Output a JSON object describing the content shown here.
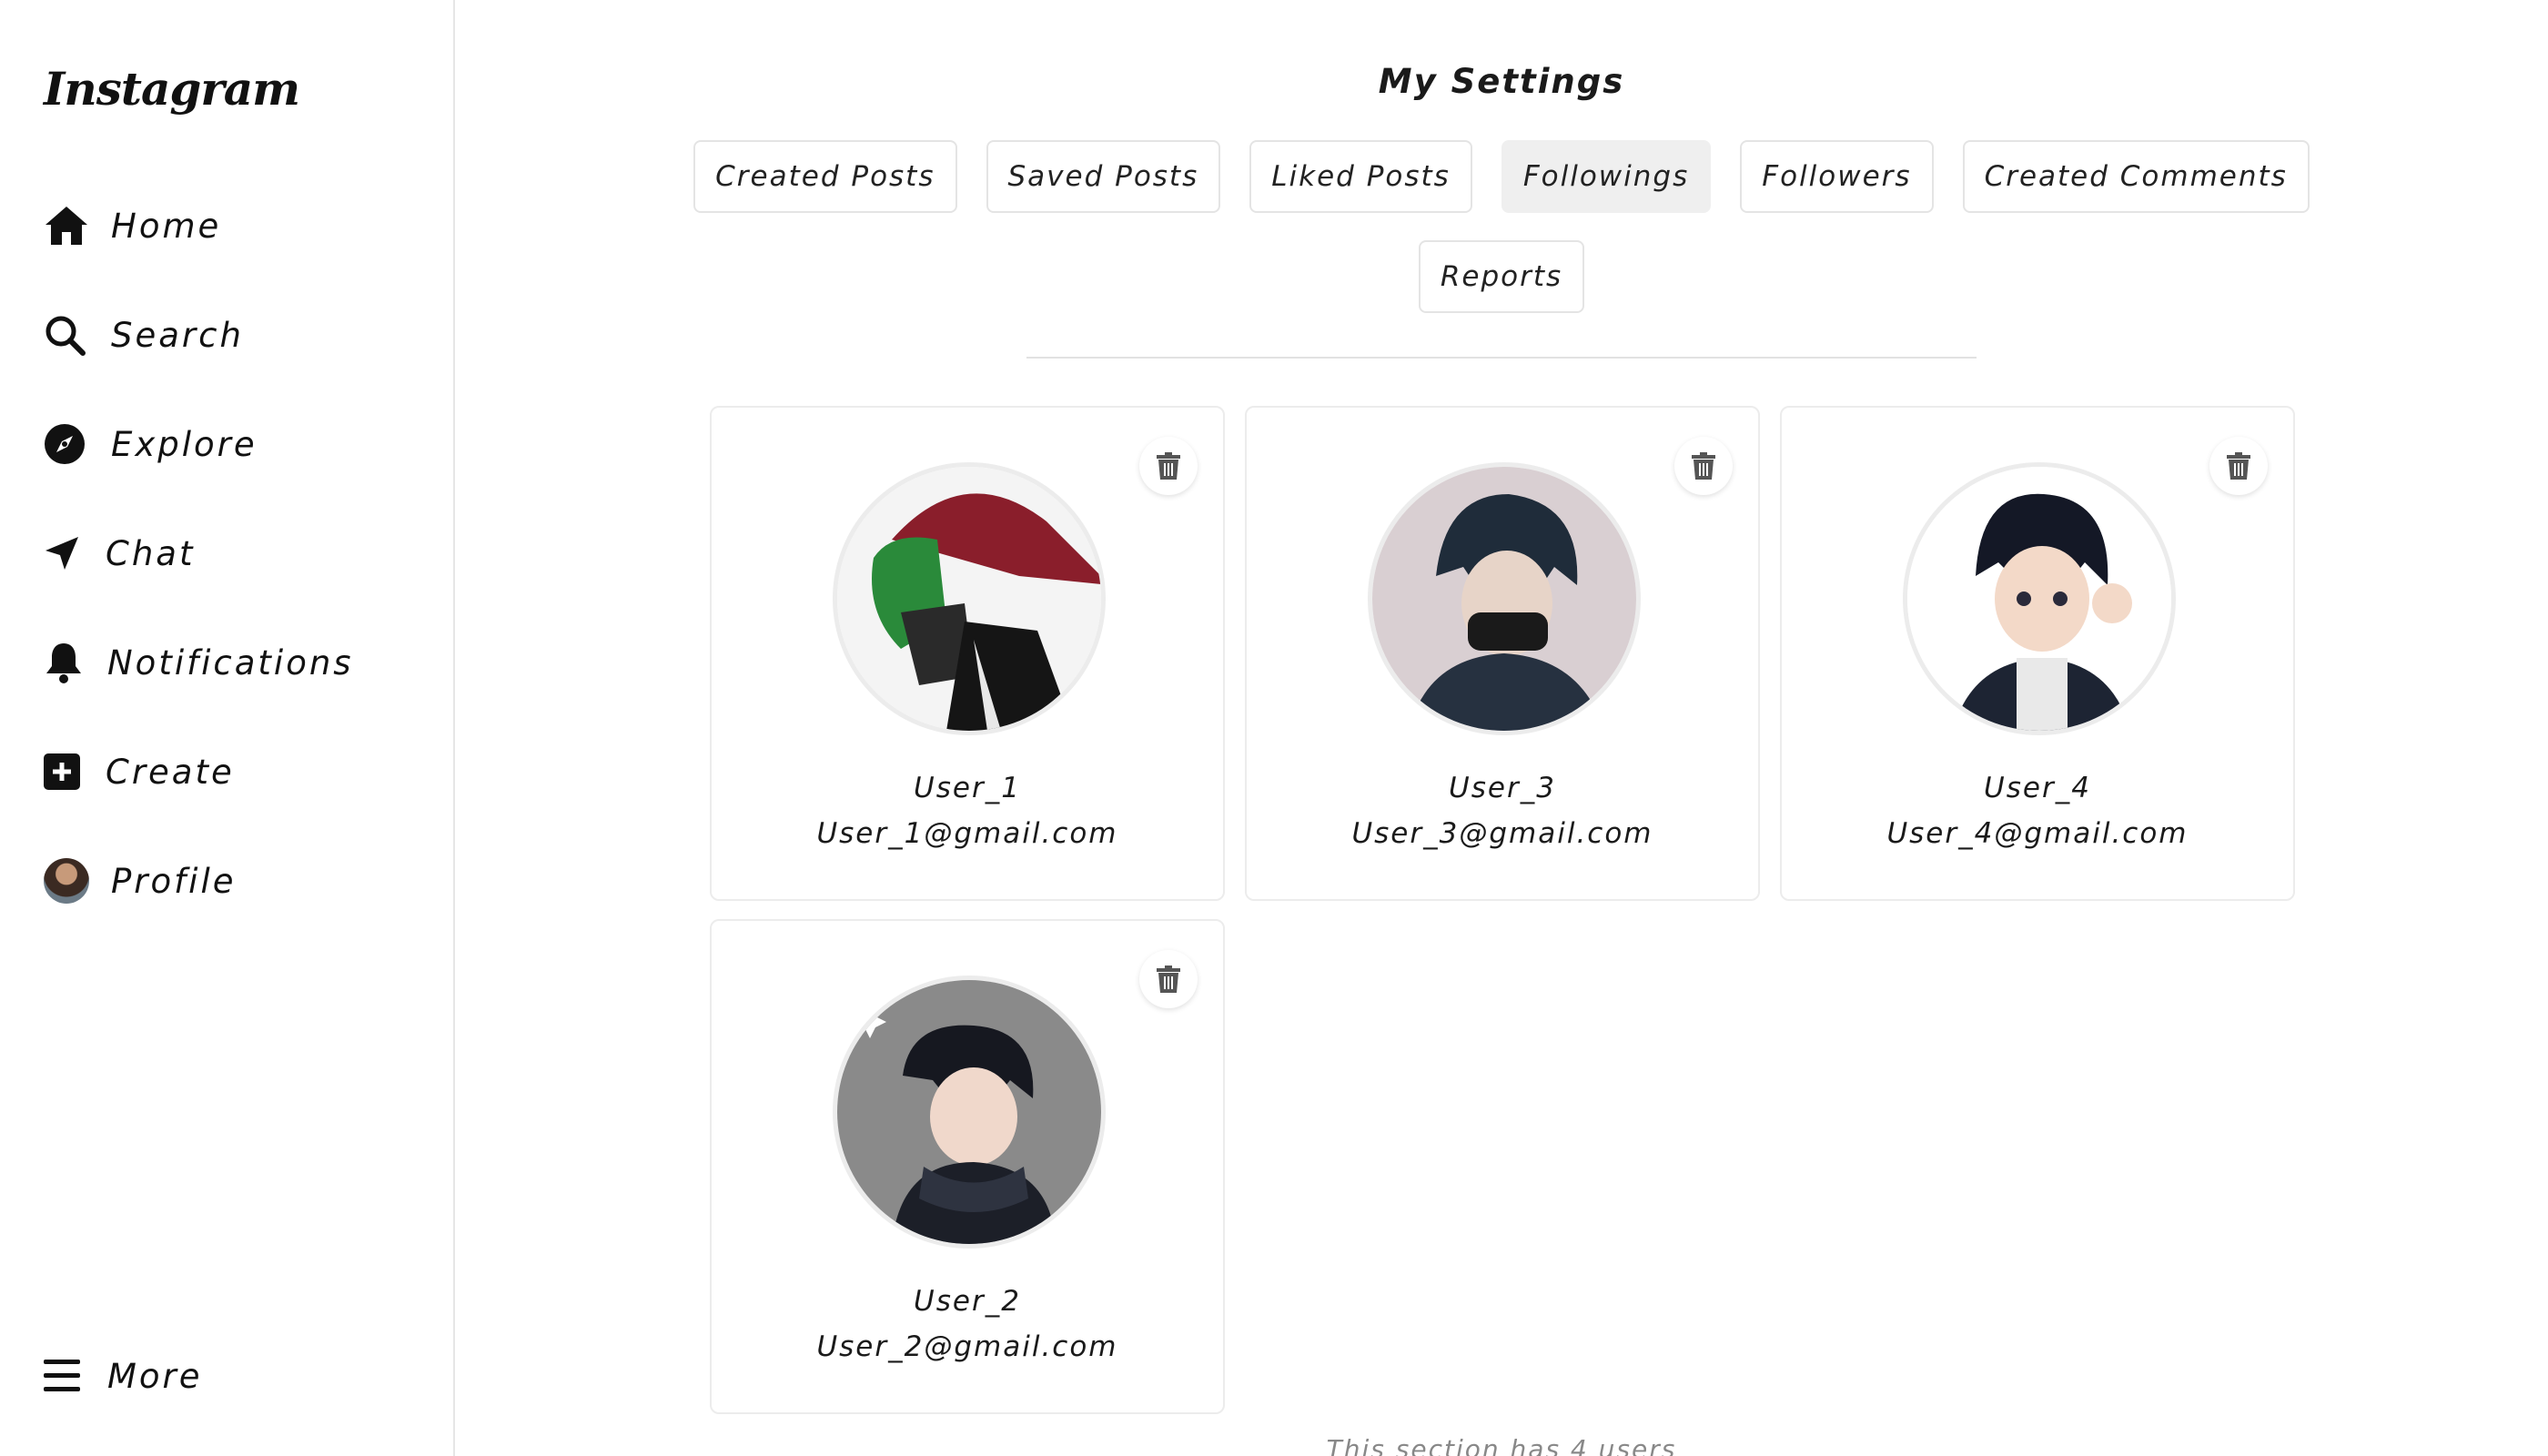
{
  "app": {
    "logo_text": "Instagram"
  },
  "sidebar": {
    "items": [
      {
        "label": "Home",
        "icon": "home-icon"
      },
      {
        "label": "Search",
        "icon": "search-icon"
      },
      {
        "label": "Explore",
        "icon": "compass-icon"
      },
      {
        "label": "Chat",
        "icon": "send-icon"
      },
      {
        "label": "Notifications",
        "icon": "bell-icon"
      },
      {
        "label": "Create",
        "icon": "plus-square-icon"
      },
      {
        "label": "Profile",
        "icon": "avatar"
      }
    ],
    "more_label": "More"
  },
  "settings": {
    "title": "My Settings",
    "tabs": [
      {
        "label": "Created Posts"
      },
      {
        "label": "Saved Posts"
      },
      {
        "label": "Liked Posts"
      },
      {
        "label": "Followings",
        "active": true
      },
      {
        "label": "Followers"
      },
      {
        "label": "Created Comments"
      },
      {
        "label": "Reports"
      }
    ]
  },
  "users": [
    {
      "username": "User_1",
      "email": "User_1@gmail.com"
    },
    {
      "username": "User_3",
      "email": "User_3@gmail.com"
    },
    {
      "username": "User_4",
      "email": "User_4@gmail.com"
    },
    {
      "username": "User_2",
      "email": "User_2@gmail.com"
    }
  ],
  "footer": {
    "note": "This section has 4 users"
  },
  "colors": {
    "active_tab_bg": "#efefef",
    "border": "#e4e4e4",
    "text": "#1a1a1a"
  }
}
